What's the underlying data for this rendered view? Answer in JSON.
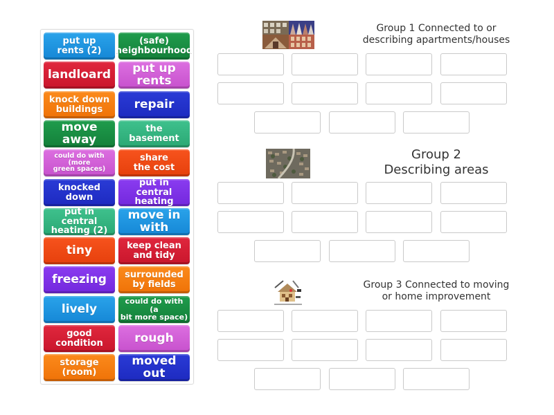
{
  "tiles": [
    {
      "label": "put up\nrents (2)",
      "color": "#1e95e0"
    },
    {
      "label": "(safe)\nneighbourhood",
      "color": "#1a8f45"
    },
    {
      "label": "landloard",
      "color": "#d41f35"
    },
    {
      "label": "put up rents",
      "color": "#d262d7"
    },
    {
      "label": "knock down\nbuildings",
      "color": "#f57e12"
    },
    {
      "label": "repair",
      "color": "#2333cb"
    },
    {
      "label": "move away",
      "color": "#1a8f45"
    },
    {
      "label": "the\nbasement",
      "color": "#35b580"
    },
    {
      "label": "could do with (more\ngreen spaces)",
      "color": "#d262d7"
    },
    {
      "label": "share\nthe cost",
      "color": "#ef4a14"
    },
    {
      "label": "knocked\ndown",
      "color": "#2333cb"
    },
    {
      "label": "put in central\nheating",
      "color": "#7f32e6"
    },
    {
      "label": "put in central\nheating (2)",
      "color": "#35b580"
    },
    {
      "label": "move in with",
      "color": "#1e95e0"
    },
    {
      "label": "tiny",
      "color": "#ef4a14"
    },
    {
      "label": "keep clean\nand tidy",
      "color": "#d41f35"
    },
    {
      "label": "freezing",
      "color": "#7f32e6"
    },
    {
      "label": "surrounded\nby fields",
      "color": "#f57e12"
    },
    {
      "label": "lively",
      "color": "#1e95e0"
    },
    {
      "label": "could do with (a\nbit more space)",
      "color": "#1a8f45"
    },
    {
      "label": "good\ncondition",
      "color": "#d41f35"
    },
    {
      "label": "rough",
      "color": "#d262d7"
    },
    {
      "label": "storage\n(room)",
      "color": "#f57e12"
    },
    {
      "label": "moved out",
      "color": "#2333cb"
    }
  ],
  "groups": [
    {
      "title": "Group 1 Connected to or\ndescribing apartments/houses",
      "image": "apartments-houses-collage",
      "slots": 11
    },
    {
      "title": "Group 2\nDescribing areas",
      "image": "aerial-neighbourhood-photo",
      "slots": 11
    },
    {
      "title": "Group 3 Connected to moving\nor home improvement",
      "image": "house-with-tools-illustration",
      "slots": 11
    }
  ]
}
